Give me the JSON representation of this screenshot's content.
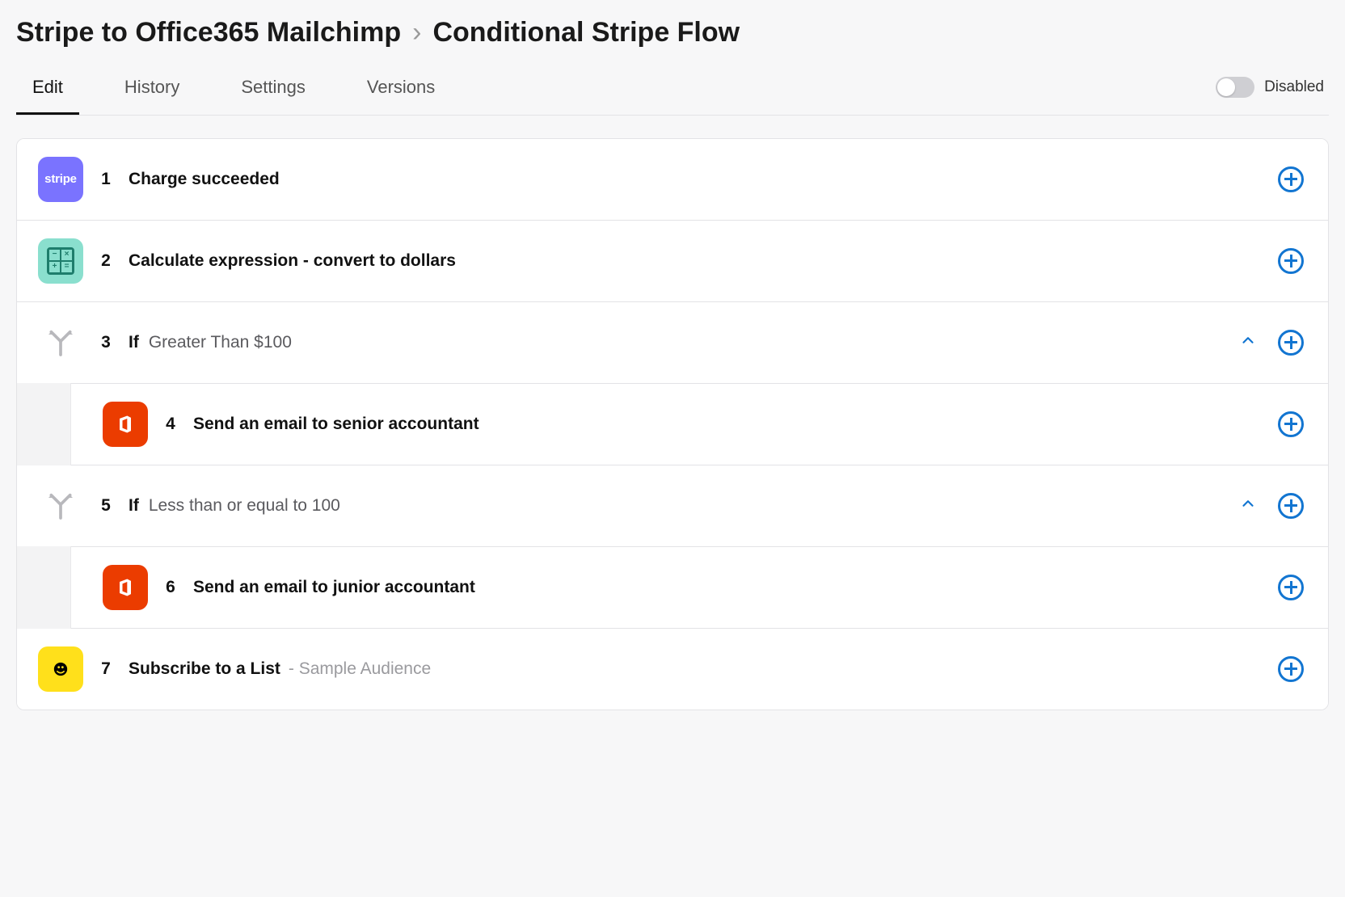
{
  "breadcrumb": {
    "parent": "Stripe to Office365 Mailchimp",
    "current": "Conditional Stripe Flow"
  },
  "tabs": {
    "edit": "Edit",
    "history": "History",
    "settings": "Settings",
    "versions": "Versions"
  },
  "toggle": {
    "state_label": "Disabled"
  },
  "steps": [
    {
      "num": "1",
      "title": "Charge succeeded",
      "icon": "stripe",
      "nested": false
    },
    {
      "num": "2",
      "title": "Calculate expression - convert to dollars",
      "icon": "calc",
      "nested": false
    },
    {
      "num": "3",
      "if_label": "If",
      "condition": "Greater Than $100",
      "icon": "branch",
      "nested": false,
      "collapsible": true
    },
    {
      "num": "4",
      "title": "Send an email to senior accountant",
      "icon": "office",
      "nested": true
    },
    {
      "num": "5",
      "if_label": "If",
      "condition": "Less than or equal to 100",
      "icon": "branch",
      "nested": false,
      "collapsible": true
    },
    {
      "num": "6",
      "title": "Send an email to junior accountant",
      "icon": "office",
      "nested": true
    },
    {
      "num": "7",
      "title": "Subscribe to a List",
      "suffix": " - Sample Audience",
      "icon": "mailchimp",
      "nested": false
    }
  ],
  "icons": {
    "stripe_text": "stripe"
  }
}
